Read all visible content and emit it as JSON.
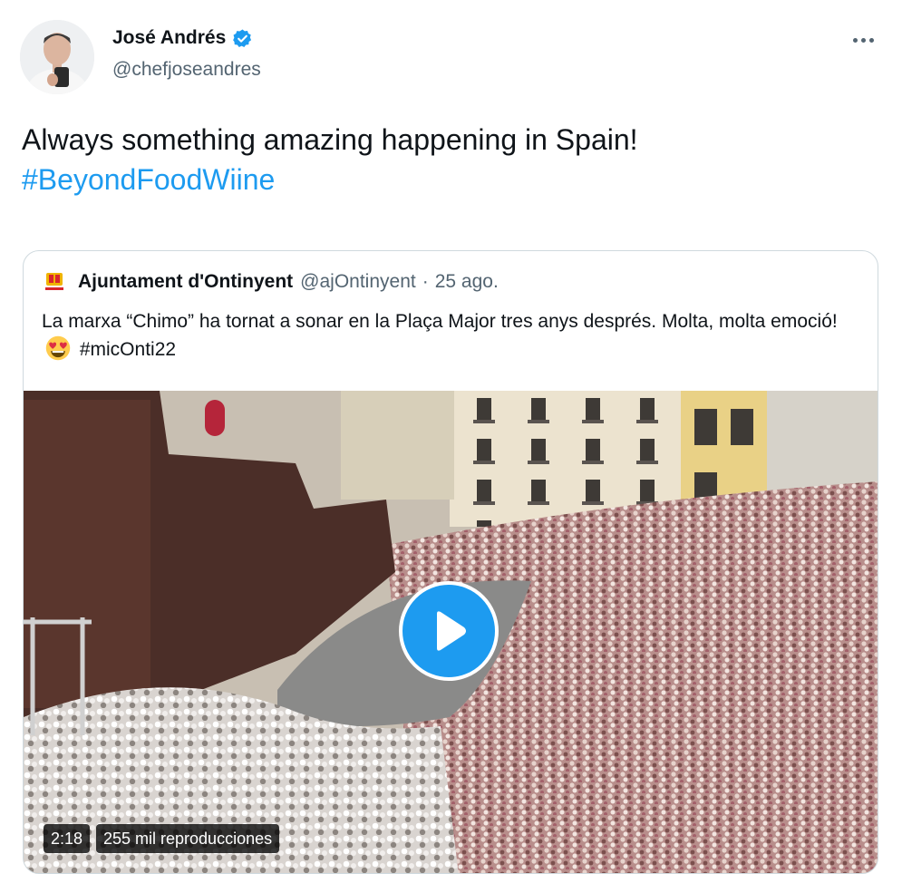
{
  "author": {
    "name": "José Andrés",
    "handle": "@chefjoseandres",
    "verified": true
  },
  "tweet": {
    "text": "Always something amazing happening in Spain!",
    "hashtag": "#BeyondFoodWiine"
  },
  "quote": {
    "name": "Ajuntament d'Ontinyent",
    "handle": "@ajOntinyent",
    "separator": "·",
    "date": "25 ago.",
    "text_before_emoji": "La marxa “Chimo” ha tornat a sonar en la Plaça Major tres anys després. Molta, molta emoció!",
    "emoji": "smiling-face-with-heart-eyes",
    "hashtag": "#micOnti22"
  },
  "video": {
    "duration": "2:18",
    "views": "255 mil reproducciones"
  },
  "colors": {
    "accent": "#1d9bf0",
    "text": "#0f1419",
    "secondary": "#536471",
    "border": "#cfd9de"
  },
  "icons": {
    "verified": "verified-badge-icon",
    "more": "more-options-icon",
    "play": "play-icon",
    "logo": "ajuntament-logo"
  }
}
